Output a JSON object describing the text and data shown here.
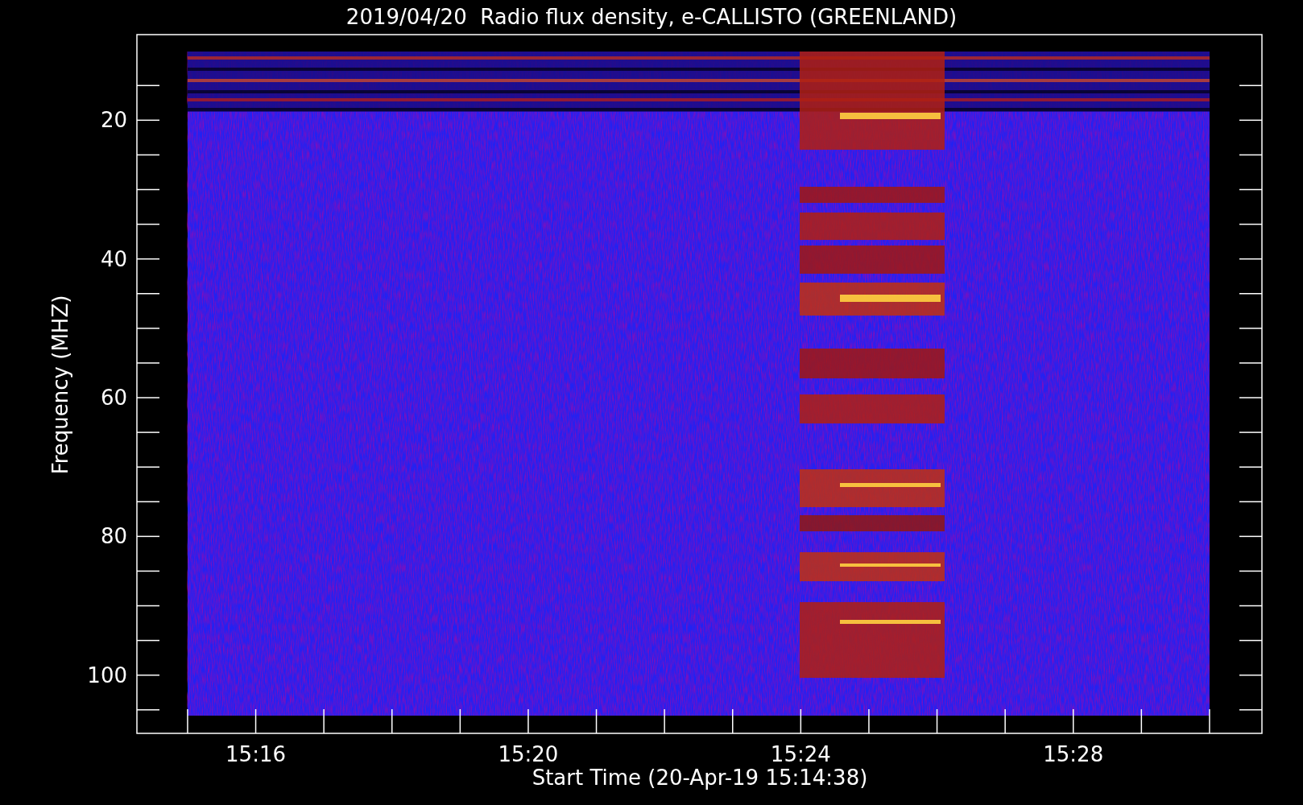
{
  "plot": {
    "title": "2019/04/20  Radio flux density, e-CALLISTO (GREENLAND)",
    "xlabel": "Start Time (20-Apr-19 15:14:38)",
    "ylabel": "Frequency (MHZ)",
    "xtick_labels": [
      "15:16",
      "15:20",
      "15:24",
      "15:28"
    ],
    "ytick_labels": [
      "20",
      "40",
      "60",
      "80",
      "100"
    ]
  }
}
